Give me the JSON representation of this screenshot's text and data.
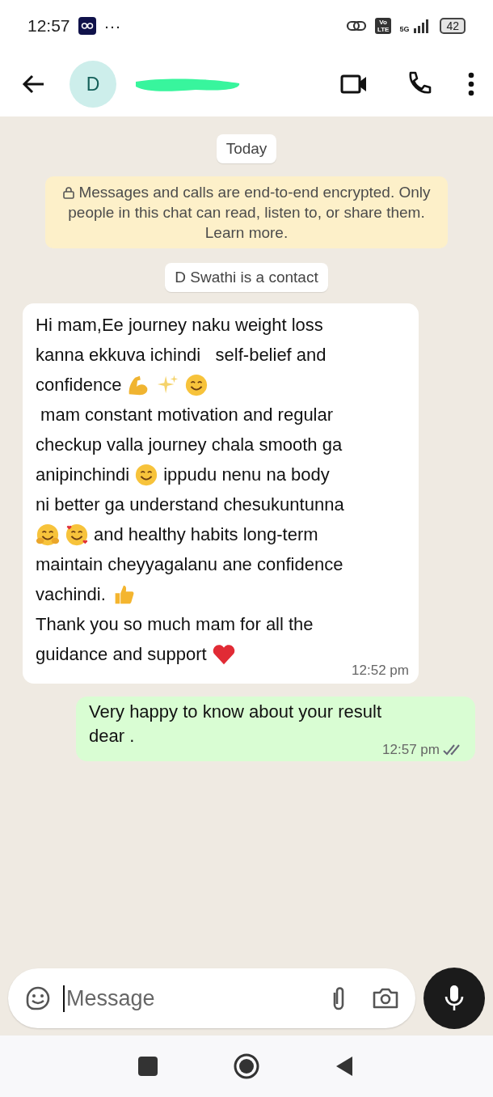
{
  "status_bar": {
    "time": "12:57",
    "more": "···",
    "volte": [
      "Vo",
      "LTE"
    ],
    "network": "5G",
    "battery": "42"
  },
  "header": {
    "avatar_letter": "D"
  },
  "chat": {
    "date_chip": "Today",
    "encryption_notice": "Messages and calls are end-to-end encrypted. Only people in this chat can read, listen to, or share them. Learn more.",
    "contact_notice": "D Swathi is a contact",
    "messages": [
      {
        "kind": "incoming",
        "lines": [
          [
            {
              "kind": "text",
              "text": "Hi mam,Ee journey naku weight loss"
            }
          ],
          [
            {
              "kind": "text",
              "text": "kanna ekkuva ichindi   self-belief and"
            }
          ],
          [
            {
              "kind": "text",
              "text": "confidence"
            },
            {
              "kind": "muscle"
            },
            {
              "kind": "sparkles"
            },
            {
              "kind": "smile"
            }
          ],
          [
            {
              "kind": "text",
              "text": " mam constant motivation and regular"
            }
          ],
          [
            {
              "kind": "text",
              "text": "checkup valla journey chala smooth ga"
            }
          ],
          [
            {
              "kind": "text",
              "text": "anipinchindi"
            },
            {
              "kind": "smile"
            },
            {
              "kind": "text",
              "text": "ippudu nenu na body"
            }
          ],
          [
            {
              "kind": "text",
              "text": "ni better ga understand chesukuntunna"
            }
          ],
          [
            {
              "kind": "hug"
            },
            {
              "kind": "hearts"
            },
            {
              "kind": "text",
              "text": "and healthy habits long-term"
            }
          ],
          [
            {
              "kind": "text",
              "text": "maintain cheyyagalanu ane confidence"
            }
          ],
          [
            {
              "kind": "text",
              "text": "vachindi."
            },
            {
              "kind": "thumbs"
            }
          ],
          [
            {
              "kind": "text",
              "text": "Thank you so much mam for all the"
            }
          ],
          [
            {
              "kind": "text",
              "text": "guidance and support"
            },
            {
              "kind": "heart"
            }
          ]
        ],
        "time": "12:52 pm"
      },
      {
        "kind": "outgoing",
        "lines": [
          [
            {
              "kind": "text",
              "text": "Very happy to know about your result"
            }
          ],
          [
            {
              "kind": "text",
              "text": "dear ."
            }
          ]
        ],
        "time": "12:57 pm",
        "read": false
      }
    ]
  },
  "composer": {
    "placeholder": "Message"
  }
}
